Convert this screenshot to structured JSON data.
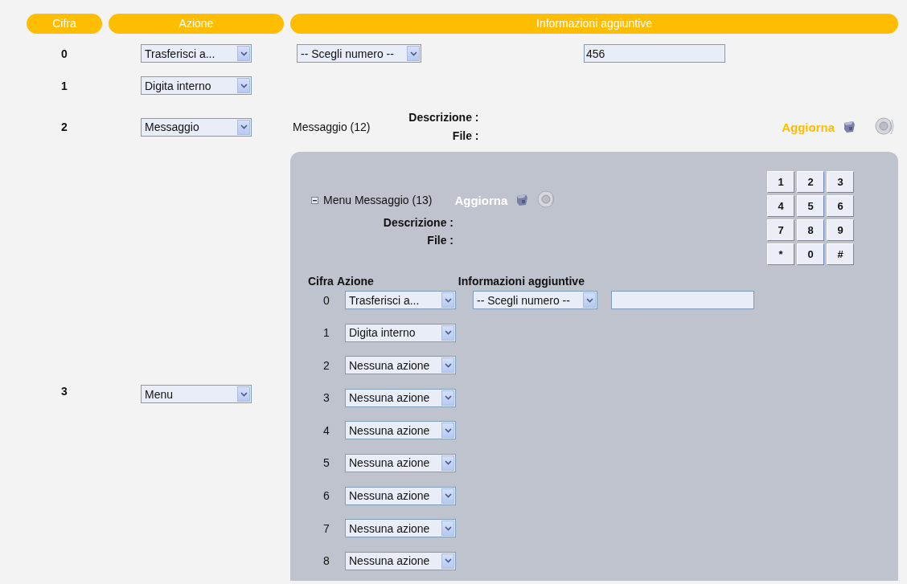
{
  "columns": [
    "Cifra",
    "Azione",
    "Informazioni aggiuntive"
  ],
  "rows": [
    {
      "digit": "0",
      "kind": "transfer",
      "action": "Trasferisci a...",
      "number_select": "-- Scegli numero --",
      "number": "456"
    },
    {
      "digit": "1",
      "kind": "extension",
      "action": "Digita interno"
    },
    {
      "digit": "2",
      "kind": "message",
      "action": "Messaggio",
      "message": {
        "name": "Messaggio (12)",
        "description_label": "Descrizione :",
        "file_label": "File :",
        "update": "Aggiorna"
      }
    },
    {
      "digit": "3",
      "kind": "menu",
      "action": "Menu",
      "menu": {
        "expanded": true,
        "name": "Menu Messaggio (13)",
        "update": "Aggiorna",
        "description_label": "Descrizione :",
        "file_label": "File :",
        "keypad": [
          "1",
          "2",
          "3",
          "4",
          "5",
          "6",
          "7",
          "8",
          "9",
          "*",
          "0",
          "#"
        ],
        "headers": [
          "Cifra",
          "Azione",
          "Informazioni aggiuntive"
        ],
        "rows": [
          {
            "digit": "0",
            "kind": "transfer",
            "action": "Trasferisci a...",
            "number_select": "-- Scegli numero --"
          },
          {
            "digit": "1",
            "kind": "extension",
            "action": "Digita interno"
          },
          {
            "digit": "2",
            "kind": "none",
            "action": "Nessuna azione"
          },
          {
            "digit": "3",
            "kind": "none",
            "action": "Nessuna azione"
          },
          {
            "digit": "4",
            "kind": "none",
            "action": "Nessuna azione"
          },
          {
            "digit": "5",
            "kind": "none",
            "action": "Nessuna azione"
          },
          {
            "digit": "6",
            "kind": "none",
            "action": "Nessuna azione"
          },
          {
            "digit": "7",
            "kind": "none",
            "action": "Nessuna azione"
          },
          {
            "digit": "8",
            "kind": "none",
            "action": "Nessuna azione"
          }
        ]
      }
    }
  ]
}
